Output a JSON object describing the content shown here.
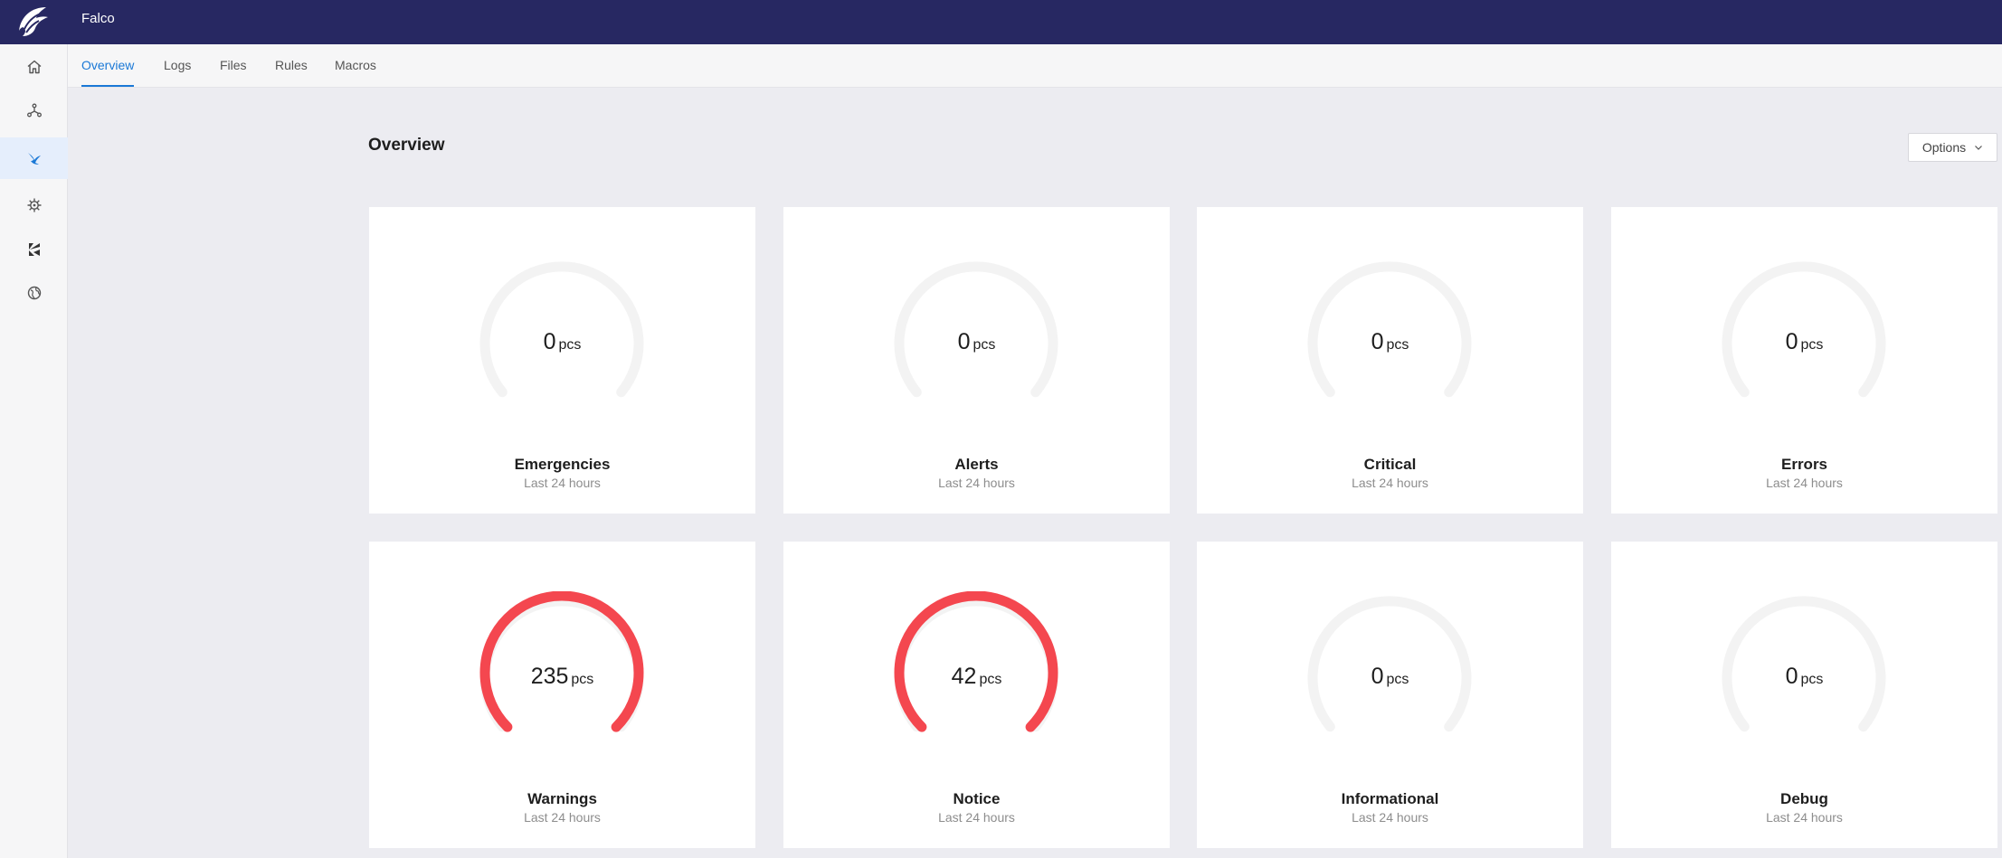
{
  "app": {
    "title": "Falco"
  },
  "sidebar": {
    "items": [
      {
        "icon": "home-icon",
        "active": false
      },
      {
        "icon": "cluster-icon",
        "active": false
      },
      {
        "icon": "falco-icon",
        "active": true
      },
      {
        "icon": "helm-icon",
        "active": false
      },
      {
        "icon": "kubernetes-k-icon",
        "active": false
      },
      {
        "icon": "globe-icon",
        "active": false
      }
    ]
  },
  "tabs": [
    {
      "label": "Overview",
      "active": true
    },
    {
      "label": "Logs",
      "active": false
    },
    {
      "label": "Files",
      "active": false
    },
    {
      "label": "Rules",
      "active": false
    },
    {
      "label": "Macros",
      "active": false
    }
  ],
  "main": {
    "title": "Overview",
    "options_label": "Options"
  },
  "colors": {
    "accent": "#1a78d6",
    "header_bg": "#272862",
    "gauge_active": "#f4474f",
    "gauge_track": "#f3f3f3"
  },
  "cards": [
    {
      "value": 0,
      "unit": "pcs",
      "title": "Emergencies",
      "subtitle": "Last 24 hours",
      "fill": 0
    },
    {
      "value": 0,
      "unit": "pcs",
      "title": "Alerts",
      "subtitle": "Last 24 hours",
      "fill": 0
    },
    {
      "value": 0,
      "unit": "pcs",
      "title": "Critical",
      "subtitle": "Last 24 hours",
      "fill": 0
    },
    {
      "value": 0,
      "unit": "pcs",
      "title": "Errors",
      "subtitle": "Last 24 hours",
      "fill": 0
    },
    {
      "value": 235,
      "unit": "pcs",
      "title": "Warnings",
      "subtitle": "Last 24 hours",
      "fill": 1
    },
    {
      "value": 42,
      "unit": "pcs",
      "title": "Notice",
      "subtitle": "Last 24 hours",
      "fill": 1
    },
    {
      "value": 0,
      "unit": "pcs",
      "title": "Informational",
      "subtitle": "Last 24 hours",
      "fill": 0
    },
    {
      "value": 0,
      "unit": "pcs",
      "title": "Debug",
      "subtitle": "Last 24 hours",
      "fill": 0
    }
  ]
}
